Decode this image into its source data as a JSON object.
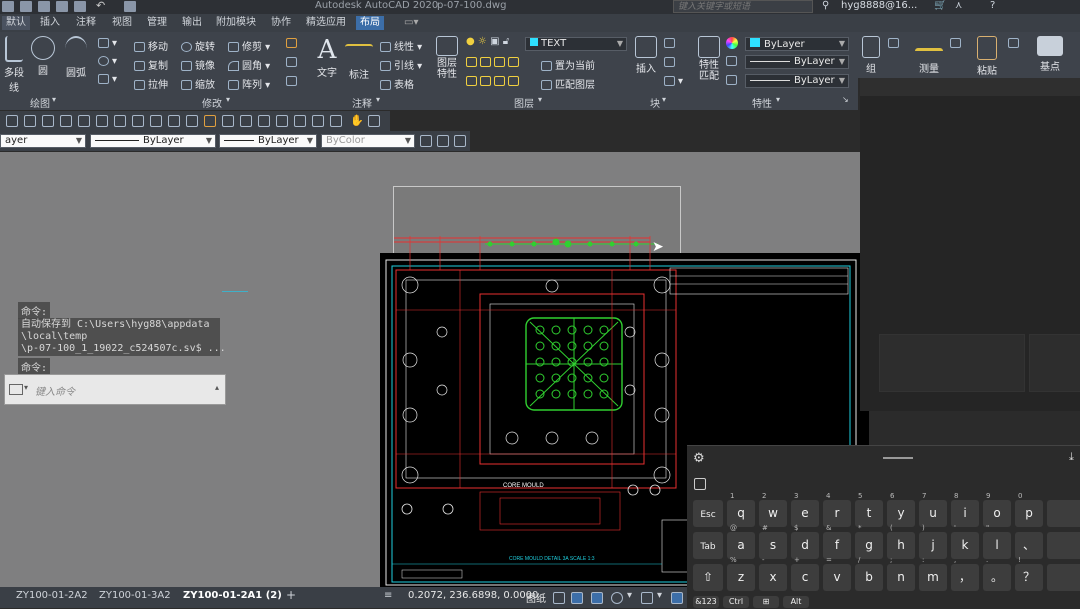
{
  "app": {
    "title": "Autodesk AutoCAD 2020",
    "filename": "p-07-100.dwg",
    "search_placeholder": "键入关键字或短语",
    "user": "hyg8888@16..."
  },
  "ribbon_tabs": [
    "默认",
    "插入",
    "注释",
    "视图",
    "管理",
    "输出",
    "附加模块",
    "协作",
    "精选应用",
    "布局"
  ],
  "ribbon": {
    "draw": {
      "title": "绘图",
      "polyline": "多段线",
      "circle": "圆",
      "arc": "圆弧"
    },
    "modify": {
      "title": "修改",
      "move": "移动",
      "rotate": "旋转",
      "trim": "修剪",
      "copy": "复制",
      "mirror": "镜像",
      "fillet": "圆角",
      "stretch": "拉伸",
      "scale": "缩放",
      "array": "阵列"
    },
    "annotation": {
      "title": "注释",
      "text": "文字",
      "dimension": "标注",
      "linetype": "线性",
      "leader": "引线",
      "table": "表格"
    },
    "layers": {
      "title": "图层",
      "properties": "图层\n特性",
      "current_layer": "TEXT",
      "set_current": "置为当前",
      "match_layer": "匹配图层"
    },
    "block": {
      "title": "块",
      "insert": "插入"
    },
    "properties": {
      "title": "特性",
      "match": "特性\n匹配",
      "color": "ByLayer",
      "linetype": "ByLayer",
      "lineweight": "ByLayer"
    },
    "group": "组",
    "measure": "测量",
    "paste": "粘贴",
    "base": "基点"
  },
  "toolbar2": {
    "layer": "ayer",
    "linetype": "ByLayer",
    "lineweight": "ByLayer",
    "color": "ByColor"
  },
  "command": {
    "label1": "命令:",
    "autosave": "自动保存到 C:\\Users\\hyg88\\appdata\n\\local\\temp\n\\p-07-100_1_19022_c524507c.sv$ ...",
    "label2": "命令:",
    "placeholder": "键入命令"
  },
  "drawing": {
    "title": "CORE MOULD",
    "detail": "CORE MOULD    DETAIL 3A  SCALE 1:3"
  },
  "layout_tabs": [
    "ZY100-01-2A2",
    "ZY100-01-3A2",
    "ZY100-01-2A1 (2)"
  ],
  "status": {
    "coords": "0.2072, 236.6898, 0.0000",
    "mode": "图纸"
  },
  "keyboard": {
    "row1": [
      {
        "k": "Esc",
        "s": ""
      },
      {
        "k": "q",
        "s": "1"
      },
      {
        "k": "w",
        "s": "2"
      },
      {
        "k": "e",
        "s": "3"
      },
      {
        "k": "r",
        "s": "4"
      },
      {
        "k": "t",
        "s": "5"
      },
      {
        "k": "y",
        "s": "6"
      },
      {
        "k": "u",
        "s": "7"
      },
      {
        "k": "i",
        "s": "8"
      },
      {
        "k": "o",
        "s": "9"
      },
      {
        "k": "p",
        "s": "0"
      }
    ],
    "row2": [
      {
        "k": "Tab",
        "s": ""
      },
      {
        "k": "a",
        "s": "@"
      },
      {
        "k": "s",
        "s": "#"
      },
      {
        "k": "d",
        "s": "$"
      },
      {
        "k": "f",
        "s": "&"
      },
      {
        "k": "g",
        "s": "*"
      },
      {
        "k": "h",
        "s": "("
      },
      {
        "k": "j",
        "s": ")"
      },
      {
        "k": "k",
        "s": "'"
      },
      {
        "k": "l",
        "s": "\""
      },
      {
        "k": "、",
        "s": ""
      }
    ],
    "row3": [
      {
        "k": "⇧",
        "s": ""
      },
      {
        "k": "z",
        "s": "%"
      },
      {
        "k": "x",
        "s": "-"
      },
      {
        "k": "c",
        "s": "+"
      },
      {
        "k": "v",
        "s": "="
      },
      {
        "k": "b",
        "s": "/"
      },
      {
        "k": "n",
        "s": ";"
      },
      {
        "k": "m",
        "s": ":"
      },
      {
        "k": "，",
        "s": ","
      },
      {
        "k": "。",
        "s": "."
      },
      {
        "k": "？",
        "s": "!"
      }
    ],
    "row4": [
      "&123",
      "Ctrl",
      "⊞",
      "Alt"
    ]
  }
}
